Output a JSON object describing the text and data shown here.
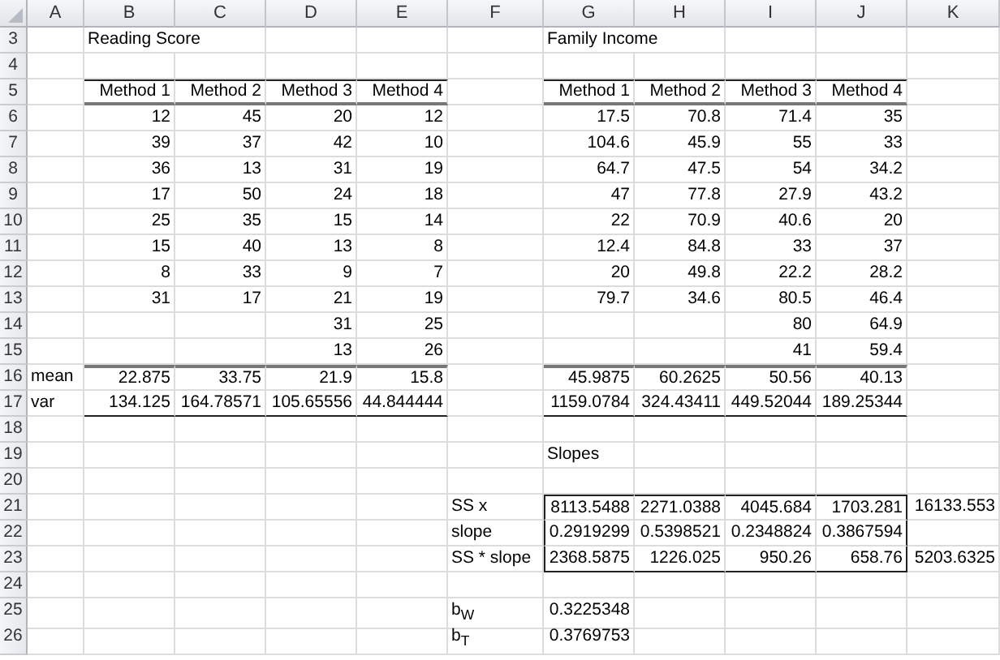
{
  "columns": [
    "A",
    "B",
    "C",
    "D",
    "E",
    "F",
    "G",
    "H",
    "I",
    "J",
    "K"
  ],
  "rows": [
    {
      "number": "3",
      "cells": [
        null,
        {
          "text": "Reading Score",
          "kind": "title"
        },
        null,
        null,
        null,
        null,
        {
          "text": "Family Income",
          "kind": "title"
        },
        null,
        null,
        null,
        null
      ]
    },
    {
      "number": "4",
      "cells": [
        null,
        null,
        null,
        null,
        null,
        null,
        null,
        null,
        null,
        null,
        null
      ]
    },
    {
      "number": "5",
      "cells": [
        null,
        {
          "text": "Method 1",
          "kind": "header"
        },
        {
          "text": "Method 2",
          "kind": "header"
        },
        {
          "text": "Method 3",
          "kind": "header"
        },
        {
          "text": "Method 4",
          "kind": "header"
        },
        null,
        {
          "text": "Method 1",
          "kind": "header"
        },
        {
          "text": "Method 2",
          "kind": "header"
        },
        {
          "text": "Method 3",
          "kind": "header"
        },
        {
          "text": "Method 4",
          "kind": "header"
        },
        null
      ]
    },
    {
      "number": "6",
      "cells": [
        null,
        {
          "text": "12",
          "kind": "value"
        },
        {
          "text": "45",
          "kind": "value"
        },
        {
          "text": "20",
          "kind": "value"
        },
        {
          "text": "12",
          "kind": "value"
        },
        null,
        {
          "text": "17.5",
          "kind": "value"
        },
        {
          "text": "70.8",
          "kind": "value"
        },
        {
          "text": "71.4",
          "kind": "value"
        },
        {
          "text": "35",
          "kind": "value"
        },
        null
      ]
    },
    {
      "number": "7",
      "cells": [
        null,
        {
          "text": "39",
          "kind": "value"
        },
        {
          "text": "37",
          "kind": "value"
        },
        {
          "text": "42",
          "kind": "value"
        },
        {
          "text": "10",
          "kind": "value"
        },
        null,
        {
          "text": "104.6",
          "kind": "value"
        },
        {
          "text": "45.9",
          "kind": "value"
        },
        {
          "text": "55",
          "kind": "value"
        },
        {
          "text": "33",
          "kind": "value"
        },
        null
      ]
    },
    {
      "number": "8",
      "cells": [
        null,
        {
          "text": "36",
          "kind": "value"
        },
        {
          "text": "13",
          "kind": "value"
        },
        {
          "text": "31",
          "kind": "value"
        },
        {
          "text": "19",
          "kind": "value"
        },
        null,
        {
          "text": "64.7",
          "kind": "value"
        },
        {
          "text": "47.5",
          "kind": "value"
        },
        {
          "text": "54",
          "kind": "value"
        },
        {
          "text": "34.2",
          "kind": "value"
        },
        null
      ]
    },
    {
      "number": "9",
      "cells": [
        null,
        {
          "text": "17",
          "kind": "value"
        },
        {
          "text": "50",
          "kind": "value"
        },
        {
          "text": "24",
          "kind": "value"
        },
        {
          "text": "18",
          "kind": "value"
        },
        null,
        {
          "text": "47",
          "kind": "value"
        },
        {
          "text": "77.8",
          "kind": "value"
        },
        {
          "text": "27.9",
          "kind": "value"
        },
        {
          "text": "43.2",
          "kind": "value"
        },
        null
      ]
    },
    {
      "number": "10",
      "cells": [
        null,
        {
          "text": "25",
          "kind": "value"
        },
        {
          "text": "35",
          "kind": "value"
        },
        {
          "text": "15",
          "kind": "value"
        },
        {
          "text": "14",
          "kind": "value"
        },
        null,
        {
          "text": "22",
          "kind": "value"
        },
        {
          "text": "70.9",
          "kind": "value"
        },
        {
          "text": "40.6",
          "kind": "value"
        },
        {
          "text": "20",
          "kind": "value"
        },
        null
      ]
    },
    {
      "number": "11",
      "cells": [
        null,
        {
          "text": "15",
          "kind": "value"
        },
        {
          "text": "40",
          "kind": "value"
        },
        {
          "text": "13",
          "kind": "value"
        },
        {
          "text": "8",
          "kind": "value"
        },
        null,
        {
          "text": "12.4",
          "kind": "value"
        },
        {
          "text": "84.8",
          "kind": "value"
        },
        {
          "text": "33",
          "kind": "value"
        },
        {
          "text": "37",
          "kind": "value"
        },
        null
      ]
    },
    {
      "number": "12",
      "cells": [
        null,
        {
          "text": "8",
          "kind": "value"
        },
        {
          "text": "33",
          "kind": "value"
        },
        {
          "text": "9",
          "kind": "value"
        },
        {
          "text": "7",
          "kind": "value"
        },
        null,
        {
          "text": "20",
          "kind": "value"
        },
        {
          "text": "49.8",
          "kind": "value"
        },
        {
          "text": "22.2",
          "kind": "value"
        },
        {
          "text": "28.2",
          "kind": "value"
        },
        null
      ]
    },
    {
      "number": "13",
      "cells": [
        null,
        {
          "text": "31",
          "kind": "value"
        },
        {
          "text": "17",
          "kind": "value"
        },
        {
          "text": "21",
          "kind": "value"
        },
        {
          "text": "19",
          "kind": "value"
        },
        null,
        {
          "text": "79.7",
          "kind": "value"
        },
        {
          "text": "34.6",
          "kind": "value"
        },
        {
          "text": "80.5",
          "kind": "value"
        },
        {
          "text": "46.4",
          "kind": "value"
        },
        null
      ]
    },
    {
      "number": "14",
      "cells": [
        null,
        null,
        null,
        {
          "text": "31",
          "kind": "value"
        },
        {
          "text": "25",
          "kind": "value"
        },
        null,
        null,
        null,
        {
          "text": "80",
          "kind": "value"
        },
        {
          "text": "64.9",
          "kind": "value"
        },
        null
      ]
    },
    {
      "number": "15",
      "cells": [
        null,
        null,
        null,
        {
          "text": "13",
          "kind": "value"
        },
        {
          "text": "26",
          "kind": "value"
        },
        null,
        null,
        null,
        {
          "text": "41",
          "kind": "value"
        },
        {
          "text": "59.4",
          "kind": "value"
        },
        null
      ]
    },
    {
      "number": "16",
      "cells": [
        {
          "text": "mean",
          "kind": "text"
        },
        {
          "text": "22.875",
          "kind": "value"
        },
        {
          "text": "33.75",
          "kind": "value"
        },
        {
          "text": "21.9",
          "kind": "value"
        },
        {
          "text": "15.8",
          "kind": "value"
        },
        null,
        {
          "text": "45.9875",
          "kind": "value"
        },
        {
          "text": "60.2625",
          "kind": "value"
        },
        {
          "text": "50.56",
          "kind": "value"
        },
        {
          "text": "40.13",
          "kind": "value"
        },
        null
      ]
    },
    {
      "number": "17",
      "cells": [
        {
          "text": "var",
          "kind": "text"
        },
        {
          "text": "134.125",
          "kind": "value"
        },
        {
          "text": "164.78571",
          "kind": "value"
        },
        {
          "text": "105.65556",
          "kind": "value"
        },
        {
          "text": "44.844444",
          "kind": "value"
        },
        null,
        {
          "text": "1159.0784",
          "kind": "value"
        },
        {
          "text": "324.43411",
          "kind": "value"
        },
        {
          "text": "449.52044",
          "kind": "value"
        },
        {
          "text": "189.25344",
          "kind": "value"
        },
        null
      ]
    },
    {
      "number": "18",
      "cells": [
        null,
        null,
        null,
        null,
        null,
        null,
        null,
        null,
        null,
        null,
        null
      ]
    },
    {
      "number": "19",
      "cells": [
        null,
        null,
        null,
        null,
        null,
        null,
        {
          "text": "Slopes",
          "kind": "text"
        },
        null,
        null,
        null,
        null
      ]
    },
    {
      "number": "20",
      "cells": [
        null,
        null,
        null,
        null,
        null,
        null,
        null,
        null,
        null,
        null,
        null
      ]
    },
    {
      "number": "21",
      "cells": [
        null,
        null,
        null,
        null,
        null,
        {
          "text": "SS x",
          "kind": "text"
        },
        {
          "text": "8113.5488",
          "kind": "value"
        },
        {
          "text": "2271.0388",
          "kind": "value"
        },
        {
          "text": "4045.684",
          "kind": "value"
        },
        {
          "text": "1703.281",
          "kind": "value"
        },
        {
          "text": "16133.553",
          "kind": "value"
        }
      ]
    },
    {
      "number": "22",
      "cells": [
        null,
        null,
        null,
        null,
        null,
        {
          "text": "slope",
          "kind": "text"
        },
        {
          "text": "0.2919299",
          "kind": "value"
        },
        {
          "text": "0.5398521",
          "kind": "value"
        },
        {
          "text": "0.2348824",
          "kind": "value"
        },
        {
          "text": "0.3867594",
          "kind": "value"
        },
        null
      ]
    },
    {
      "number": "23",
      "cells": [
        null,
        null,
        null,
        null,
        null,
        {
          "text": "SS * slope",
          "kind": "text"
        },
        {
          "text": "2368.5875",
          "kind": "value"
        },
        {
          "text": "1226.025",
          "kind": "value"
        },
        {
          "text": "950.26",
          "kind": "value"
        },
        {
          "text": "658.76",
          "kind": "value"
        },
        {
          "text": "5203.6325",
          "kind": "value"
        }
      ]
    },
    {
      "number": "24",
      "cells": [
        null,
        null,
        null,
        null,
        null,
        null,
        null,
        null,
        null,
        null,
        null
      ]
    },
    {
      "number": "25",
      "cells": [
        null,
        null,
        null,
        null,
        null,
        {
          "text": "b$_{W}$",
          "kind": "text"
        },
        {
          "text": "0.3225348",
          "kind": "value"
        },
        null,
        null,
        null,
        null
      ]
    },
    {
      "number": "26",
      "cells": [
        null,
        null,
        null,
        null,
        null,
        {
          "text": "b$_{T}$",
          "kind": "text"
        },
        {
          "text": "0.3769753",
          "kind": "value"
        },
        null,
        null,
        null,
        null
      ]
    }
  ]
}
